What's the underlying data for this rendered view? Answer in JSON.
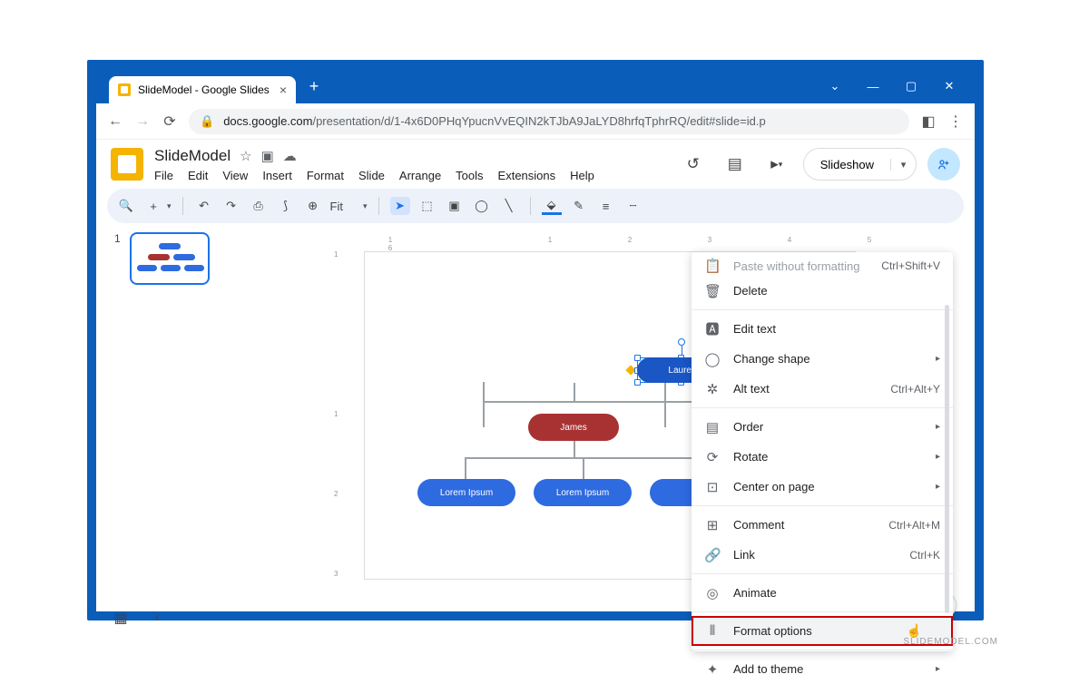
{
  "browser": {
    "tab_title": "SlideModel - Google Slides",
    "url_host": "docs.google.com",
    "url_path": "/presentation/d/1-4x6D0PHqYpucnVvEQIN2kTJbA9JaLYD8hrfqTphrRQ/edit#slide=id.p"
  },
  "app": {
    "doc_title": "SlideModel",
    "menus": [
      "File",
      "Edit",
      "View",
      "Insert",
      "Format",
      "Slide",
      "Arrange",
      "Tools",
      "Extensions",
      "Help"
    ],
    "slideshow_label": "Slideshow"
  },
  "toolbar": {
    "zoom_label": "Fit"
  },
  "thumbs": {
    "num1": "1"
  },
  "ruler_h": [
    "1",
    "",
    "1",
    "2",
    "3",
    "4",
    "5",
    "6"
  ],
  "ruler_v": [
    "1",
    "",
    "1",
    "2",
    "3"
  ],
  "shapes": {
    "lauren": "Lauren",
    "james": "James",
    "li1": "Lorem Ipsum",
    "li2": "Lorem Ipsum"
  },
  "ctx": {
    "paste_nf": "Paste without formatting",
    "paste_nf_sc": "Ctrl+Shift+V",
    "delete": "Delete",
    "edit_text": "Edit text",
    "change_shape": "Change shape",
    "alt_text": "Alt text",
    "alt_text_sc": "Ctrl+Alt+Y",
    "order": "Order",
    "rotate": "Rotate",
    "center": "Center on page",
    "comment": "Comment",
    "comment_sc": "Ctrl+Alt+M",
    "link": "Link",
    "link_sc": "Ctrl+K",
    "animate": "Animate",
    "format_options": "Format options",
    "add_theme": "Add to theme"
  },
  "watermark": "SLIDEMODEL.COM"
}
